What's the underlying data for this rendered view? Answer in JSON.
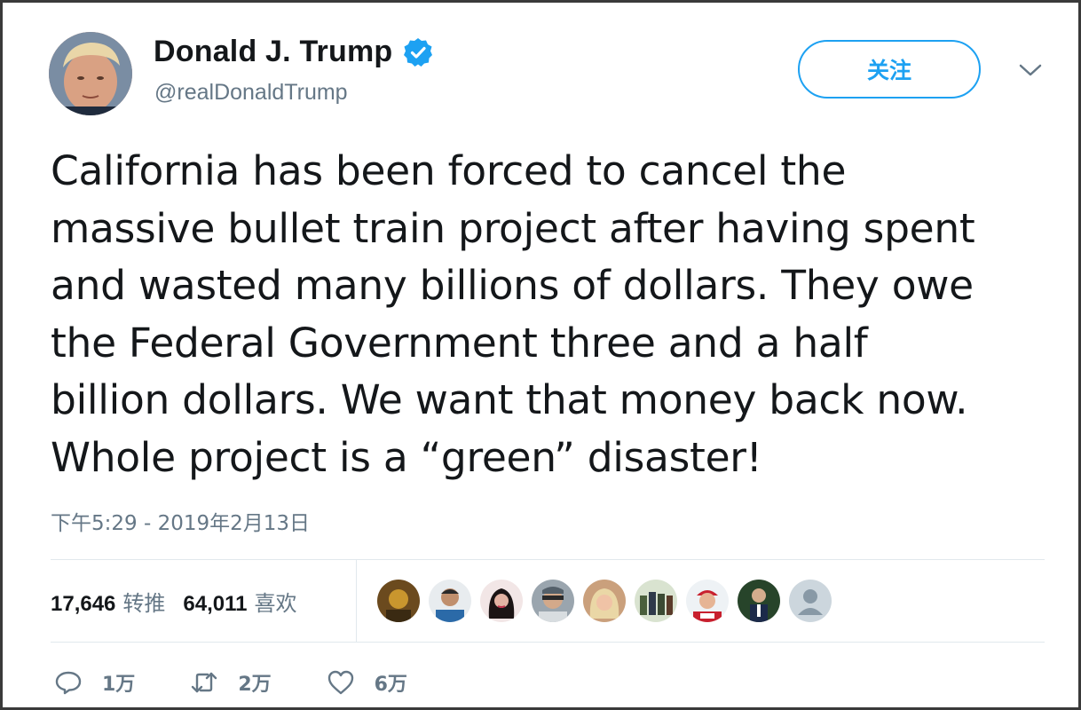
{
  "header": {
    "display_name": "Donald J. Trump",
    "handle": "@realDonaldTrump",
    "follow_label": "关注"
  },
  "tweet": {
    "text": "California has been forced to cancel the\nmassive bullet train project after having spent\nand wasted many billions of dollars. They owe\nthe Federal Government three and a half\nbillion dollars. We want that money back now.\nWhole project is a “green” disaster!",
    "timestamp": "下午5:29 - 2019年2月13日"
  },
  "stats": {
    "retweets_count": "17,646",
    "retweets_label": "转推",
    "likes_count": "64,011",
    "likes_label": "喜欢"
  },
  "actions": {
    "reply_count": "1万",
    "retweet_count": "2万",
    "like_count": "6万"
  },
  "colors": {
    "accent": "#1da1f2",
    "secondary_text": "#657786",
    "divider": "#e1e8ed"
  },
  "icons": [
    "verified-badge-icon",
    "chevron-down-icon",
    "reply-icon",
    "retweet-icon",
    "heart-icon"
  ]
}
